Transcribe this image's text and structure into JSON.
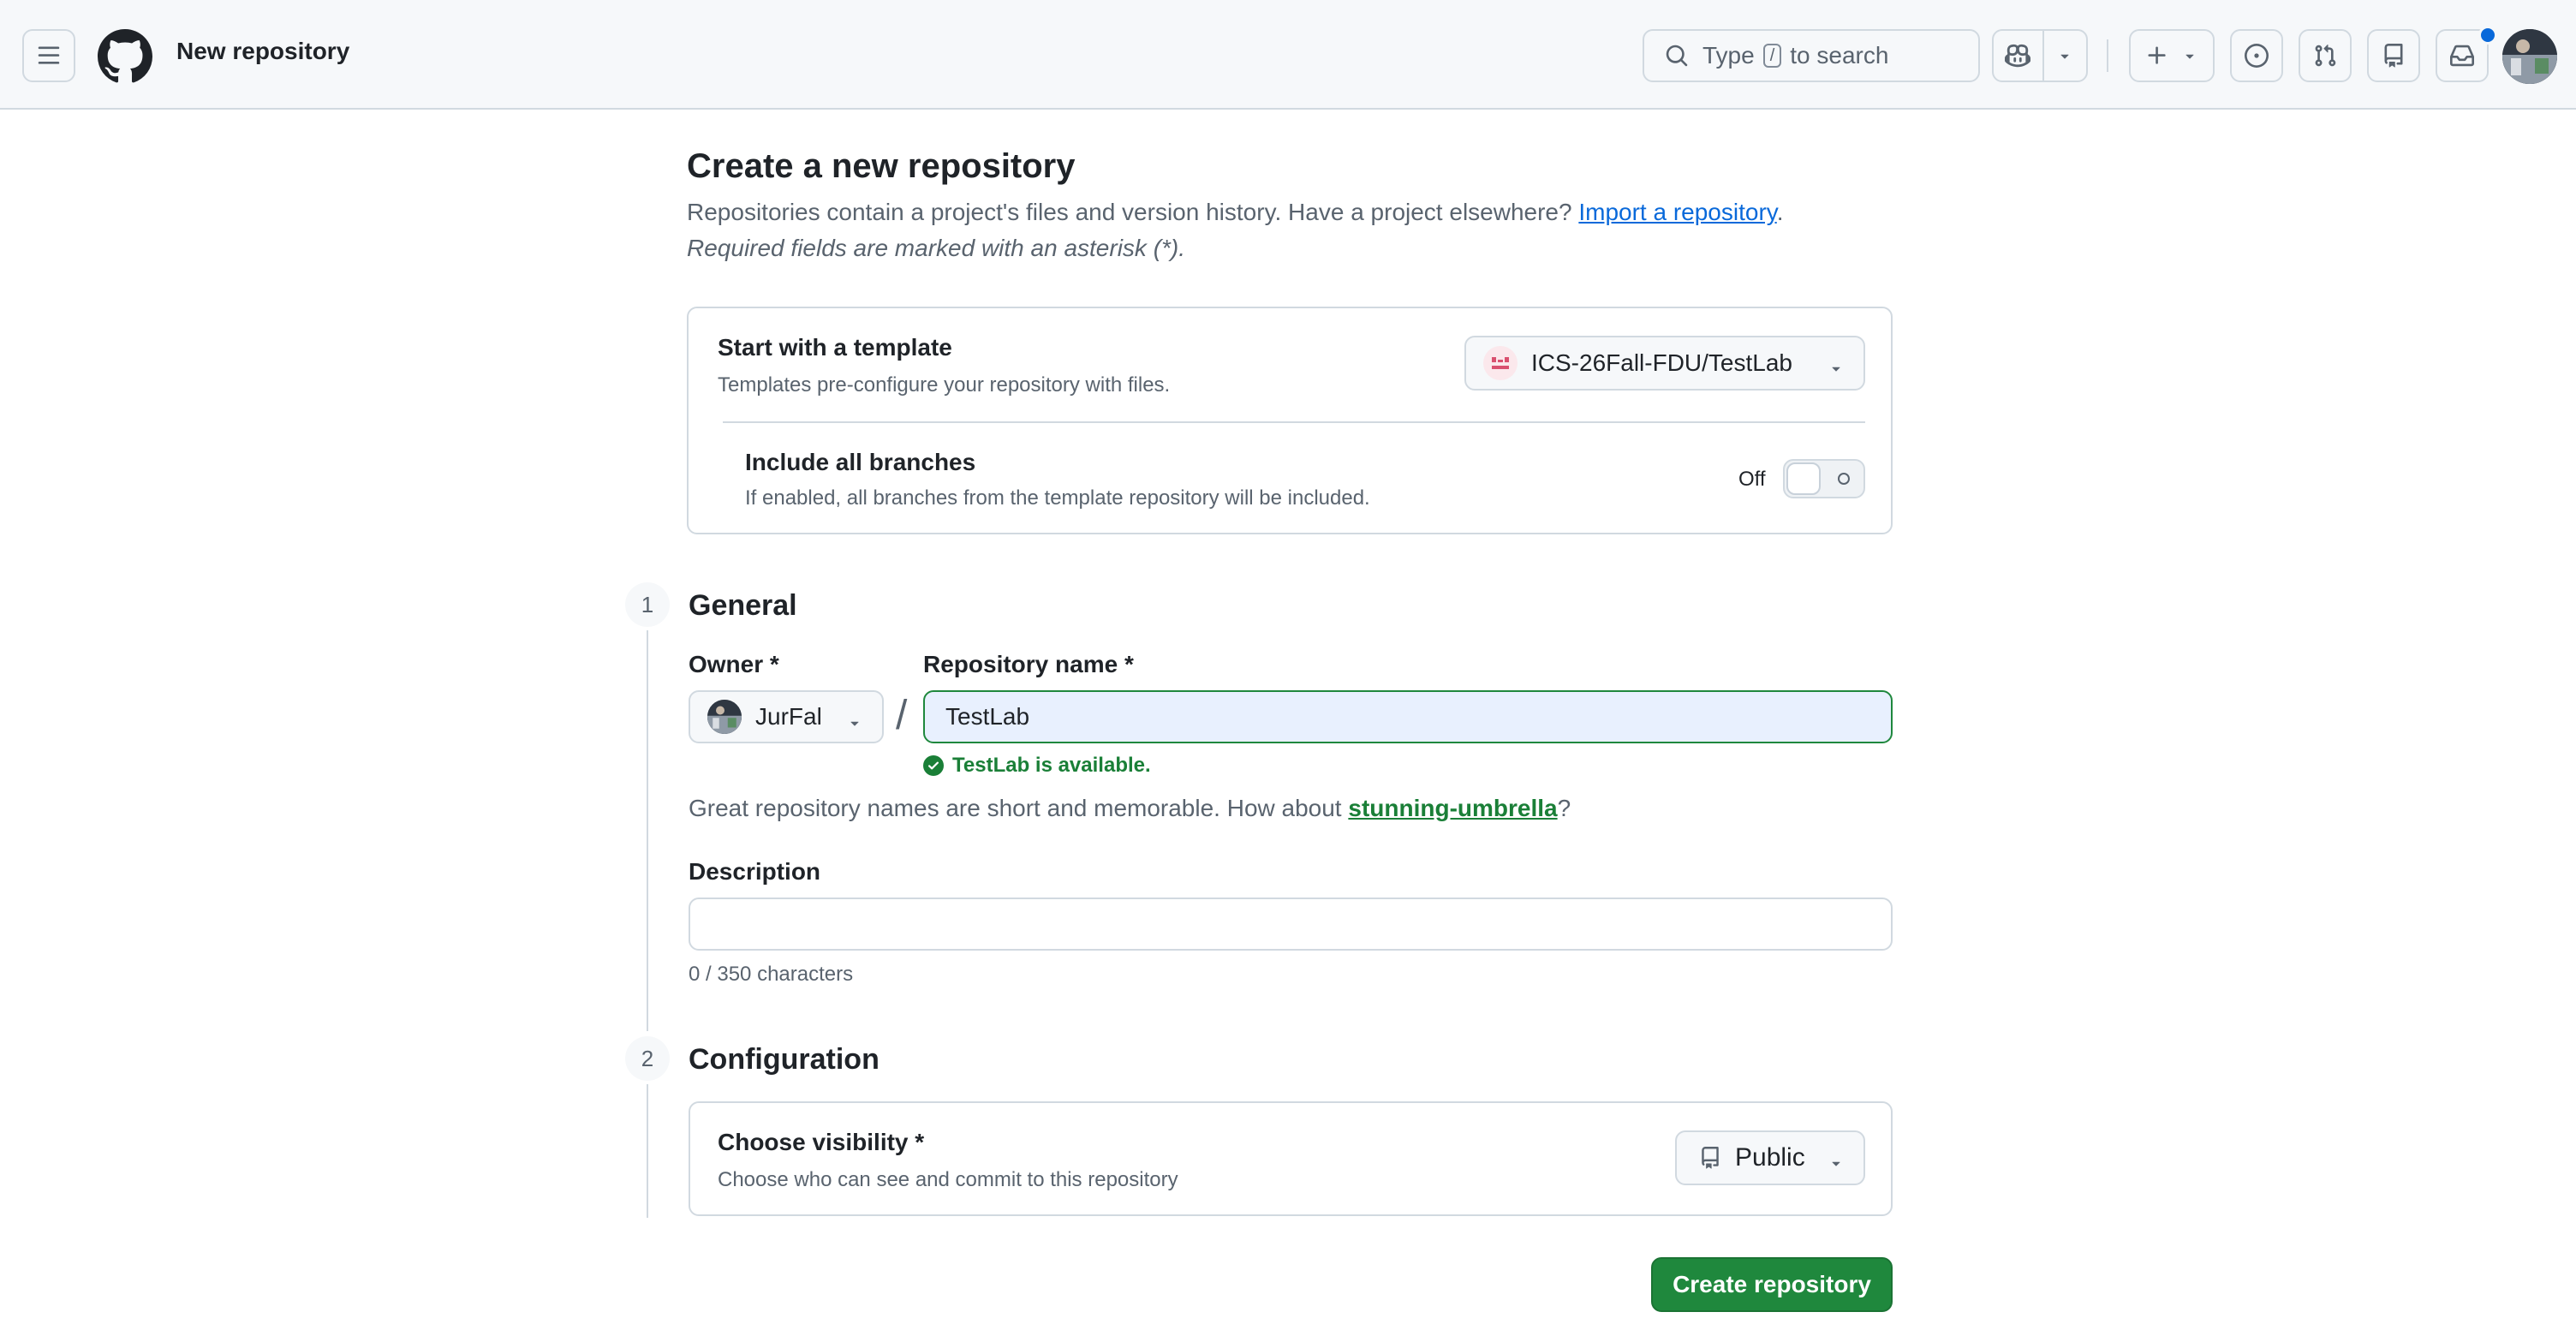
{
  "header": {
    "title": "New repository",
    "search": {
      "prefix": "Type",
      "key": "/",
      "suffix": "to search"
    },
    "icons": [
      "hamburger-icon",
      "github-logo-icon",
      "search-icon",
      "copilot-icon",
      "plus-icon",
      "issues-icon",
      "pull-requests-icon",
      "repos-icon",
      "inbox-icon"
    ]
  },
  "page": {
    "title": "Create a new repository",
    "subtitle": "Repositories contain a project's files and version history. Have a project elsewhere?",
    "import_link": "Import a repository",
    "subtitle_end": ".",
    "required_note": "Required fields are marked with an asterisk (*)."
  },
  "template": {
    "title": "Start with a template",
    "description": "Templates pre-configure your repository with files.",
    "selected": "ICS-26Fall-FDU/TestLab",
    "include_branches_title": "Include all branches",
    "include_branches_desc": "If enabled, all branches from the template repository will be included.",
    "toggle_label": "Off"
  },
  "general": {
    "step": "1",
    "title": "General",
    "owner_label": "Owner *",
    "owner_value": "JurFal",
    "slash": "/",
    "repo_label": "Repository name *",
    "repo_value": "TestLab",
    "availability": "TestLab is available.",
    "suggest_prefix": "Great repository names are short and memorable. How about",
    "suggest_name": "stunning-umbrella",
    "suggest_suffix": "?",
    "description_label": "Description",
    "description_value": "",
    "char_count": "0 / 350 characters"
  },
  "configuration": {
    "step": "2",
    "title": "Configuration",
    "visibility_title": "Choose visibility *",
    "visibility_desc": "Choose who can see and commit to this repository",
    "visibility_value": "Public"
  },
  "actions": {
    "create_label": "Create repository"
  },
  "colors": {
    "primary_green": "#1f883d",
    "link_blue": "#0969da",
    "success_green": "#1a7f37",
    "notification_blue": "#0969da"
  }
}
